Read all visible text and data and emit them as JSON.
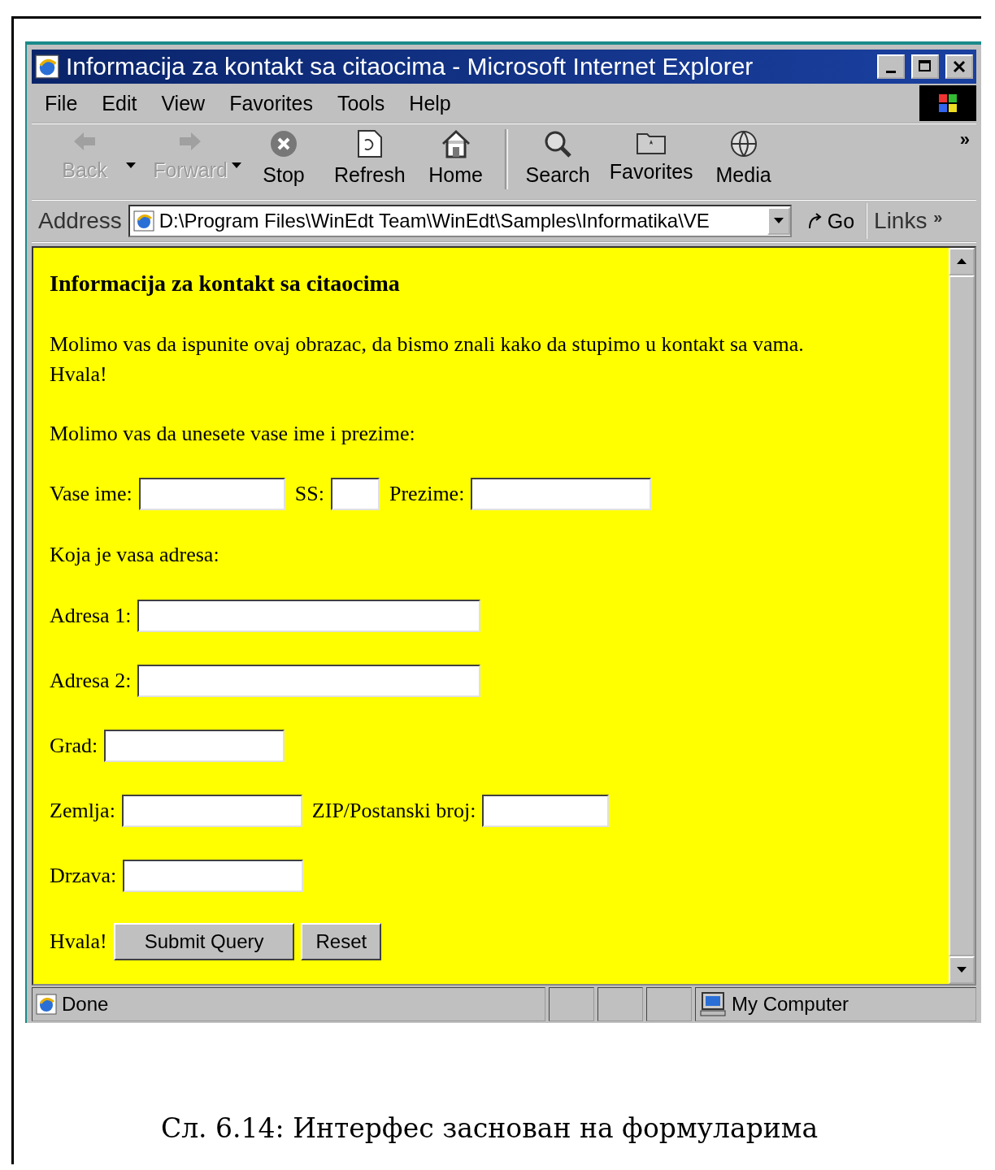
{
  "window": {
    "title": "Informacija za kontakt sa citaocima - Microsoft Internet Explorer"
  },
  "menu": [
    {
      "label": "File"
    },
    {
      "label": "Edit"
    },
    {
      "label": "View"
    },
    {
      "label": "Favorites"
    },
    {
      "label": "Tools"
    },
    {
      "label": "Help"
    }
  ],
  "toolbar": {
    "groups": [
      [
        {
          "label": "Back",
          "disabled": true,
          "dropdown": true
        },
        {
          "label": "Forward",
          "disabled": true,
          "dropdown": true
        },
        {
          "label": "Stop",
          "disabled": false,
          "dropdown": false
        },
        {
          "label": "Refresh",
          "disabled": false,
          "dropdown": false
        },
        {
          "label": "Home",
          "disabled": false,
          "dropdown": false
        }
      ],
      [
        {
          "label": "Search",
          "disabled": false,
          "dropdown": false
        },
        {
          "label": "Favorites",
          "disabled": false,
          "dropdown": false
        },
        {
          "label": "Media",
          "disabled": false,
          "dropdown": false
        }
      ]
    ],
    "more": "»"
  },
  "address": {
    "label": "Address",
    "value": "D:\\Program Files\\WinEdt Team\\WinEdt\\Samples\\Informatika\\VE",
    "go": "Go",
    "links": "Links",
    "links_more": "»"
  },
  "page": {
    "heading": "Informacija za kontakt sa citaocima",
    "paragraphs": [
      "Molimo vas da ispunite ovaj obrazac, da bismo znali kako da stupimo u kontakt sa vama. Hvala!",
      "Molimo vas da unesete vase ime i prezime:"
    ],
    "rows": [
      {
        "kind": "fields",
        "fields": [
          {
            "label": "Vase ime:"
          },
          {
            "label": "SS:"
          },
          {
            "label": "Prezime:"
          }
        ]
      },
      {
        "kind": "text",
        "text": "Koja je vasa adresa:"
      },
      {
        "kind": "fields",
        "fields": [
          {
            "label": "Adresa 1:"
          }
        ]
      },
      {
        "kind": "fields",
        "fields": [
          {
            "label": "Adresa 2:"
          }
        ]
      },
      {
        "kind": "fields",
        "fields": [
          {
            "label": "Grad:"
          }
        ]
      },
      {
        "kind": "fields",
        "fields": [
          {
            "label": "Zemlja:"
          },
          {
            "label": "ZIP/Postanski broj:"
          }
        ]
      },
      {
        "kind": "fields",
        "fields": [
          {
            "label": "Drzava:"
          }
        ]
      },
      {
        "kind": "buttons",
        "text": "Hvala!",
        "buttons": [
          "Submit Query",
          "Reset"
        ]
      }
    ]
  },
  "status": {
    "text": "Done",
    "zone": "My Computer"
  },
  "caption": "Сл. 6.14: Интерфес заснован на формуларима"
}
